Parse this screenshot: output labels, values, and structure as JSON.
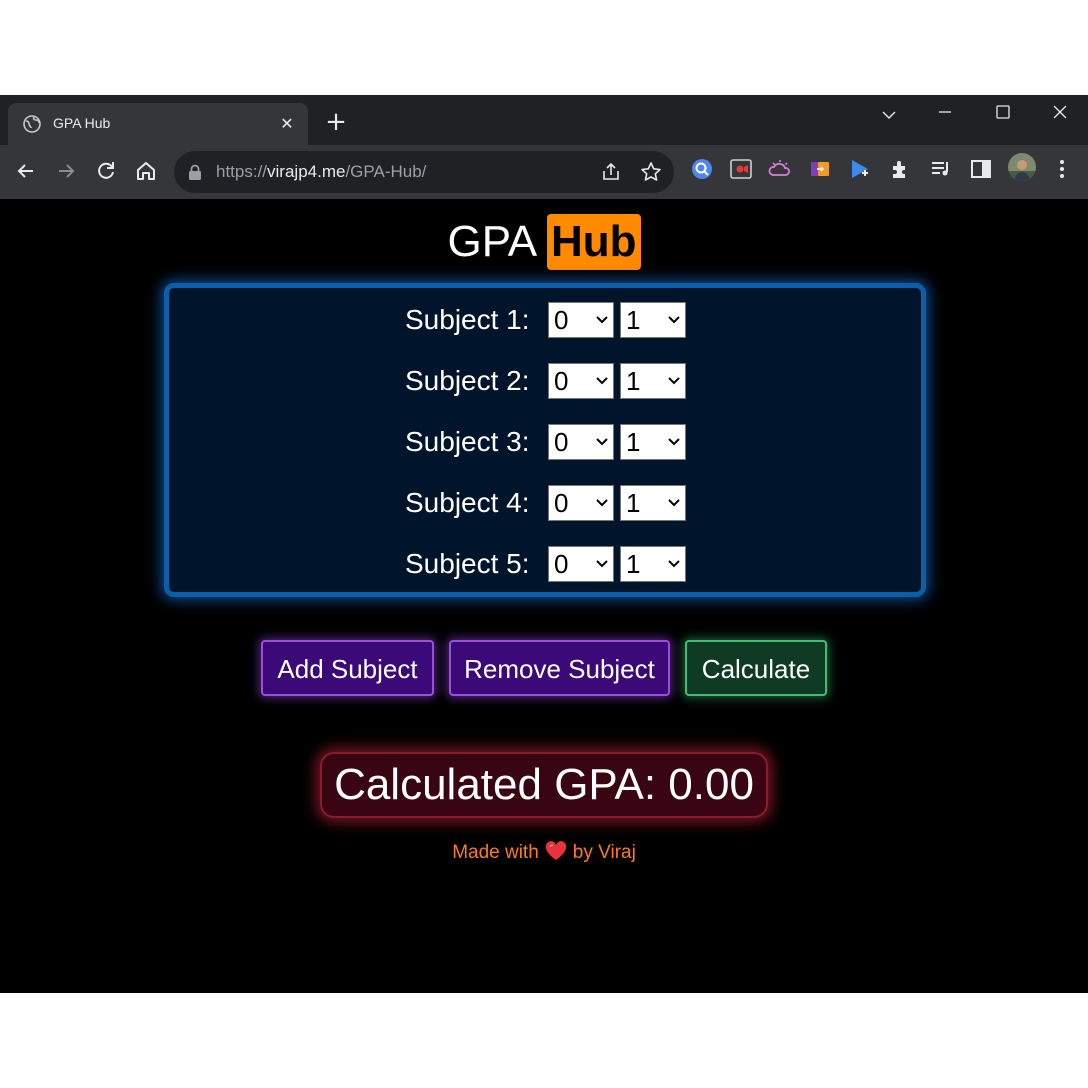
{
  "browser": {
    "tab_title": "GPA Hub",
    "tab_close": "✕",
    "new_tab": "+",
    "url_scheme": "https://",
    "url_host": "virajp4.me",
    "url_path": "/GPA-Hub/"
  },
  "page": {
    "logo_left": "GPA",
    "logo_right": "Hub",
    "subjects": [
      {
        "label": "Subject 1:",
        "grade": "0",
        "credits": "1"
      },
      {
        "label": "Subject 2:",
        "grade": "0",
        "credits": "1"
      },
      {
        "label": "Subject 3:",
        "grade": "0",
        "credits": "1"
      },
      {
        "label": "Subject 4:",
        "grade": "0",
        "credits": "1"
      },
      {
        "label": "Subject 5:",
        "grade": "0",
        "credits": "1"
      }
    ],
    "add_button": "Add Subject",
    "remove_button": "Remove Subject",
    "calculate_button": "Calculate",
    "result": "Calculated GPA: 0.00",
    "footer_before": "Made with",
    "footer_after": "by Viraj"
  },
  "colors": {
    "brand_orange": "#ff8a00",
    "panel_border": "#0a5fa8",
    "button_purple": "#3b0a78",
    "button_green": "#0f3b24",
    "result_red": "#3a0512"
  }
}
